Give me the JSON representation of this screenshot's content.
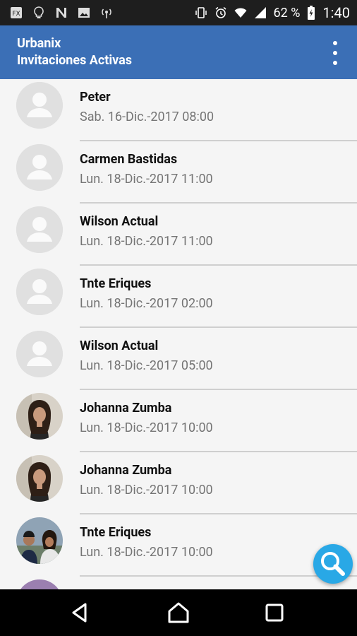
{
  "status_bar": {
    "battery_percent": "62 %",
    "time": "1:40",
    "left_icons": [
      "app-notification-icon",
      "lightbulb-icon",
      "n-app-icon",
      "image-icon",
      "broadcast-icon"
    ],
    "right_icons": [
      "vibrate-icon",
      "alarm-icon",
      "wifi-icon",
      "signal-icon",
      "battery-charging-icon"
    ]
  },
  "app_bar": {
    "app_name": "Urbanix",
    "screen_title": "Invitaciones Activas",
    "background": "#3b6fb6"
  },
  "invitations": [
    {
      "name": "Peter",
      "date": "Sab. 16-Dic.-2017 08:00",
      "avatar": "default"
    },
    {
      "name": "Carmen Bastidas",
      "date": "Lun. 18-Dic.-2017 11:00",
      "avatar": "default"
    },
    {
      "name": "Wilson Actual",
      "date": "Lun. 18-Dic.-2017 11:00",
      "avatar": "default"
    },
    {
      "name": "Tnte Eriques",
      "date": "Lun. 18-Dic.-2017 02:00",
      "avatar": "default"
    },
    {
      "name": "Wilson Actual",
      "date": "Lun. 18-Dic.-2017 05:00",
      "avatar": "default"
    },
    {
      "name": "Johanna Zumba",
      "date": "Lun. 18-Dic.-2017 10:00",
      "avatar": "photo"
    },
    {
      "name": "Johanna Zumba",
      "date": "Lun. 18-Dic.-2017 10:00",
      "avatar": "photo"
    },
    {
      "name": "Tnte Eriques",
      "date": "Lun. 18-Dic.-2017 10:00",
      "avatar": "photo"
    }
  ],
  "fab": {
    "icon": "search-icon",
    "color": "#29a8e6"
  },
  "nav_bar": {
    "icons": [
      "back-icon",
      "home-icon",
      "recents-icon"
    ]
  }
}
